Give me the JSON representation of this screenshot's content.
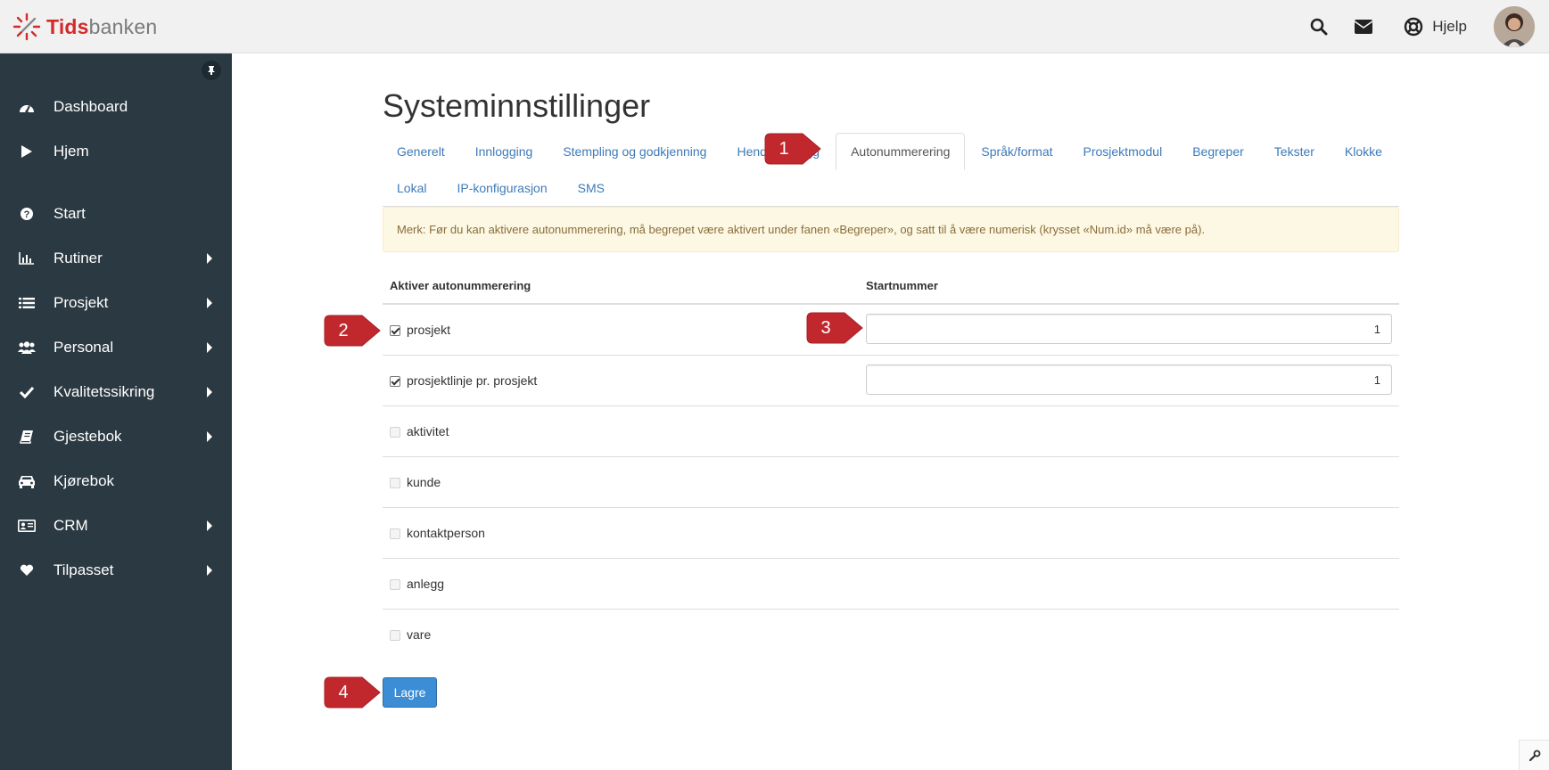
{
  "app": {
    "logo_bold": "Tids",
    "logo_light": "banken"
  },
  "header": {
    "help_label": "Hjelp",
    "icons": [
      "search-icon",
      "envelope-icon",
      "lifebuoy-icon"
    ]
  },
  "sidebar": {
    "items": [
      {
        "label": "Dashboard",
        "icon": "tachometer-icon",
        "submenu": false
      },
      {
        "label": "Hjem",
        "icon": "play-icon",
        "submenu": false
      },
      {
        "label": "Start",
        "icon": "question-circle-icon",
        "submenu": false
      },
      {
        "label": "Rutiner",
        "icon": "bar-chart-icon",
        "submenu": true
      },
      {
        "label": "Prosjekt",
        "icon": "list-icon",
        "submenu": true
      },
      {
        "label": "Personal",
        "icon": "users-icon",
        "submenu": true
      },
      {
        "label": "Kvalitetssikring",
        "icon": "check-icon",
        "submenu": true
      },
      {
        "label": "Gjestebok",
        "icon": "book-icon",
        "submenu": true
      },
      {
        "label": "Kjørebok",
        "icon": "car-icon",
        "submenu": false
      },
      {
        "label": "CRM",
        "icon": "id-card-icon",
        "submenu": true
      },
      {
        "label": "Tilpasset",
        "icon": "heart-icon",
        "submenu": true
      }
    ]
  },
  "main": {
    "title": "Systeminnstillinger",
    "tabs_row1": [
      "Generelt",
      "Innlogging",
      "Stempling og godkjenning",
      "Hendelseslogg",
      "Autonummerering",
      "Språk/format",
      "Prosjektmodul",
      "Begreper",
      "Tekster",
      "Klokke"
    ],
    "tabs_row2": [
      "Lokal",
      "IP-konfigurasjon",
      "SMS"
    ],
    "active_tab": "Autonummerering",
    "alert": "Merk: Før du kan aktivere autonummerering, må begrepet være aktivert under fanen «Begreper», og satt til å være numerisk (krysset «Num.id» må være på).",
    "table": {
      "col1": "Aktiver autonummerering",
      "col2": "Startnummer",
      "rows": [
        {
          "label": "prosjekt",
          "checked": true,
          "enabled": true,
          "start": "1"
        },
        {
          "label": "prosjektlinje pr. prosjekt",
          "checked": true,
          "enabled": true,
          "start": "1"
        },
        {
          "label": "aktivitet",
          "checked": false,
          "enabled": false
        },
        {
          "label": "kunde",
          "checked": false,
          "enabled": false
        },
        {
          "label": "kontaktperson",
          "checked": false,
          "enabled": false
        },
        {
          "label": "anlegg",
          "checked": false,
          "enabled": false
        },
        {
          "label": "vare",
          "checked": false,
          "enabled": false
        }
      ]
    },
    "save_label": "Lagre"
  },
  "markers": [
    "1",
    "2",
    "3",
    "4"
  ],
  "colors": {
    "sidebar_bg": "#2b3942",
    "link": "#3d7ab8",
    "primary": "#3c8dd6",
    "marker": "#c0282d",
    "logo_red": "#d32a2a"
  }
}
